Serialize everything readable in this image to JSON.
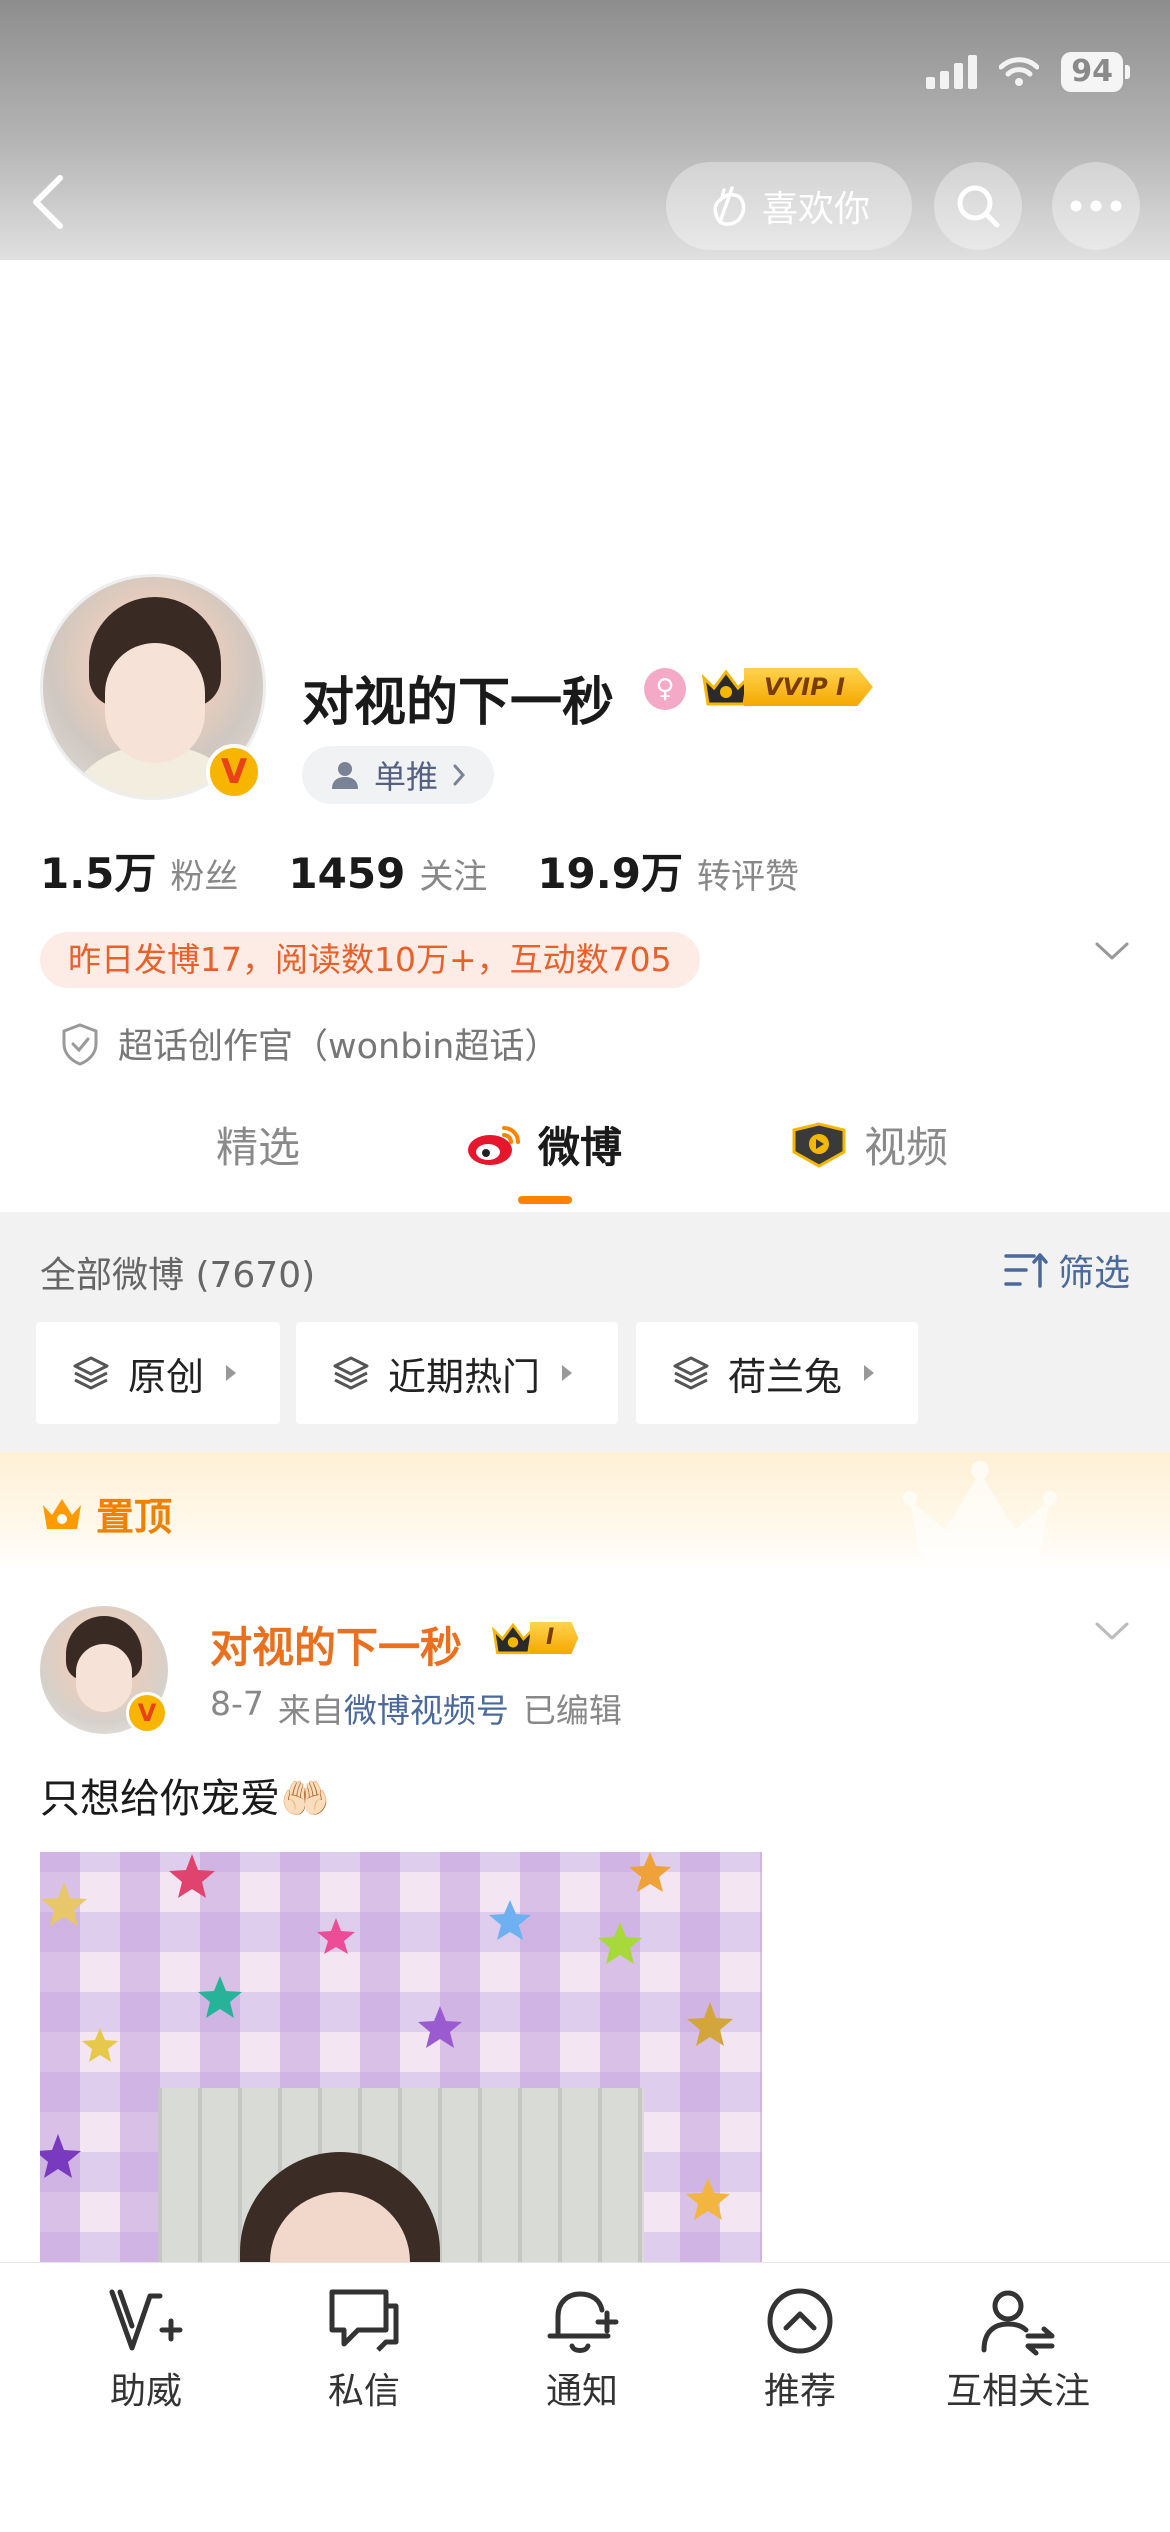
{
  "status": {
    "battery": "94"
  },
  "nav": {
    "like_label": "喜欢你"
  },
  "profile": {
    "name": "对视的下一秒",
    "vip_tag": "VVIP I",
    "verified_mark": "V",
    "gender_symbol": "♀",
    "dantui_label": "单推",
    "stats": [
      {
        "num": "1.5万",
        "label": "粉丝"
      },
      {
        "num": "1459",
        "label": "关注"
      },
      {
        "num": "19.9万",
        "label": "转评赞"
      }
    ],
    "post_info": "昨日发博17，阅读数10万+，互动数705",
    "super_label": "超话创作官（wonbin超话）"
  },
  "tabs": [
    {
      "label": "精选"
    },
    {
      "label": "微博"
    },
    {
      "label": "视频"
    }
  ],
  "filter": {
    "all_weibo": "全部微博 (7670)",
    "filter_label": "筛选",
    "chips": [
      "原创",
      "近期热门",
      "荷兰兔"
    ]
  },
  "pinned": {
    "label": "置顶"
  },
  "post": {
    "name": "对视的下一秒",
    "vip_tag": "I",
    "date": "8-7",
    "from": "来自",
    "source": "微博视频号",
    "edited": "已编辑",
    "text": "只想给你宠爱🤲🏻"
  },
  "bottom_bar": [
    {
      "label": "助威",
      "icon": "v-plus-icon"
    },
    {
      "label": "私信",
      "icon": "chat-icon"
    },
    {
      "label": "通知",
      "icon": "bell-plus-icon"
    },
    {
      "label": "推荐",
      "icon": "circle-chevron-up-icon"
    },
    {
      "label": "互相关注",
      "icon": "person-swap-icon"
    }
  ],
  "colors": {
    "accent": "#ff8200",
    "link": "#4b6a9b",
    "name_orange": "#e8701e"
  }
}
